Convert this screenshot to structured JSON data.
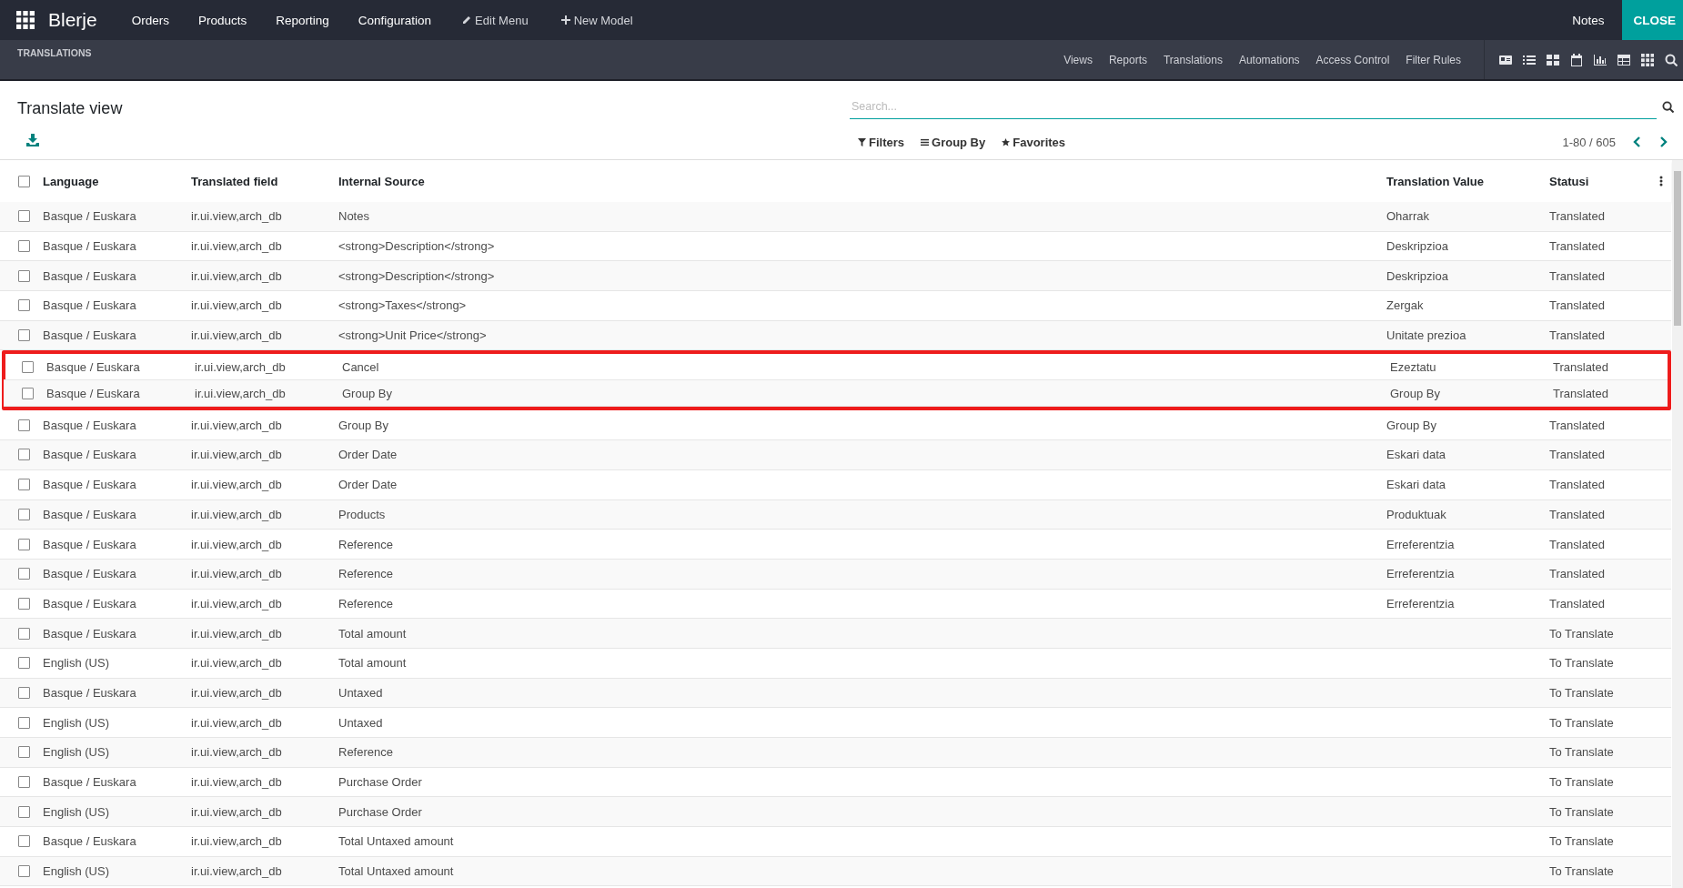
{
  "app": {
    "name": "Blerje",
    "menu": [
      "Orders",
      "Products",
      "Reporting",
      "Configuration"
    ],
    "actions": [
      {
        "kind": "edit",
        "label": "Edit Menu"
      },
      {
        "kind": "add",
        "label": "New Model"
      }
    ],
    "notes": "Notes",
    "close": "CLOSE"
  },
  "studio": {
    "title": "TRANSLATIONS",
    "tabs": [
      "Views",
      "Reports",
      "Translations",
      "Automations",
      "Access Control",
      "Filter Rules"
    ]
  },
  "control": {
    "title": "Translate view",
    "search": {
      "placeholder": "Search..."
    },
    "filters": [
      {
        "kind": "filter",
        "label": "Filters"
      },
      {
        "kind": "group",
        "label": "Group By"
      },
      {
        "kind": "favorite",
        "label": "Favorites"
      }
    ],
    "pager": "1-80 / 605"
  },
  "table": {
    "select_all": {
      "checked": false
    },
    "columns": [
      "Language",
      "Translated field",
      "Internal Source",
      "Translation Value",
      "Statusi"
    ],
    "rows": [
      {
        "cells": [
          "Basque / Euskara",
          "ir.ui.view,arch_db",
          "Notes",
          "Oharrak",
          "Translated"
        ],
        "selected": false,
        "outlined": false
      },
      {
        "cells": [
          "Basque / Euskara",
          "ir.ui.view,arch_db",
          "<strong>Description</strong>",
          "Deskripzioa",
          "Translated"
        ],
        "selected": false,
        "outlined": false
      },
      {
        "cells": [
          "Basque / Euskara",
          "ir.ui.view,arch_db",
          "<strong>Description</strong>",
          "Deskripzioa",
          "Translated"
        ],
        "selected": false,
        "outlined": false
      },
      {
        "cells": [
          "Basque / Euskara",
          "ir.ui.view,arch_db",
          "<strong>Taxes</strong>",
          "Zergak",
          "Translated"
        ],
        "selected": false,
        "outlined": false
      },
      {
        "cells": [
          "Basque / Euskara",
          "ir.ui.view,arch_db",
          "<strong>Unit Price</strong>",
          "Unitate prezioa",
          "Translated"
        ],
        "selected": false,
        "outlined": false
      },
      {
        "cells": [
          "Basque / Euskara",
          "ir.ui.view,arch_db",
          "Cancel",
          "Ezeztatu",
          "Translated"
        ],
        "selected": false,
        "outlined": true
      },
      {
        "cells": [
          "Basque / Euskara",
          "ir.ui.view,arch_db",
          "Group By",
          "Group By",
          "Translated"
        ],
        "selected": false,
        "outlined": true
      },
      {
        "cells": [
          "Basque / Euskara",
          "ir.ui.view,arch_db",
          "Group By",
          "Group By",
          "Translated"
        ],
        "selected": false,
        "outlined": false
      },
      {
        "cells": [
          "Basque / Euskara",
          "ir.ui.view,arch_db",
          "Order Date",
          "Eskari data",
          "Translated"
        ],
        "selected": false,
        "outlined": false
      },
      {
        "cells": [
          "Basque / Euskara",
          "ir.ui.view,arch_db",
          "Order Date",
          "Eskari data",
          "Translated"
        ],
        "selected": false,
        "outlined": false
      },
      {
        "cells": [
          "Basque / Euskara",
          "ir.ui.view,arch_db",
          "Products",
          "Produktuak",
          "Translated"
        ],
        "selected": false,
        "outlined": false
      },
      {
        "cells": [
          "Basque / Euskara",
          "ir.ui.view,arch_db",
          "Reference",
          "Erreferentzia",
          "Translated"
        ],
        "selected": false,
        "outlined": false
      },
      {
        "cells": [
          "Basque / Euskara",
          "ir.ui.view,arch_db",
          "Reference",
          "Erreferentzia",
          "Translated"
        ],
        "selected": false,
        "outlined": false
      },
      {
        "cells": [
          "Basque / Euskara",
          "ir.ui.view,arch_db",
          "Reference",
          "Erreferentzia",
          "Translated"
        ],
        "selected": false,
        "outlined": false
      },
      {
        "cells": [
          "Basque / Euskara",
          "ir.ui.view,arch_db",
          "Total amount",
          null,
          "To Translate"
        ],
        "selected": false,
        "outlined": false
      },
      {
        "cells": [
          "English (US)",
          "ir.ui.view,arch_db",
          "Total amount",
          null,
          "To Translate"
        ],
        "selected": false,
        "outlined": false
      },
      {
        "cells": [
          "Basque / Euskara",
          "ir.ui.view,arch_db",
          "Untaxed",
          null,
          "To Translate"
        ],
        "selected": false,
        "outlined": false
      },
      {
        "cells": [
          "English (US)",
          "ir.ui.view,arch_db",
          "Untaxed",
          null,
          "To Translate"
        ],
        "selected": false,
        "outlined": false
      },
      {
        "cells": [
          "English (US)",
          "ir.ui.view,arch_db",
          "Reference",
          null,
          "To Translate"
        ],
        "selected": false,
        "outlined": false
      },
      {
        "cells": [
          "Basque / Euskara",
          "ir.ui.view,arch_db",
          "Purchase Order",
          null,
          "To Translate"
        ],
        "selected": false,
        "outlined": false
      },
      {
        "cells": [
          "English (US)",
          "ir.ui.view,arch_db",
          "Purchase Order",
          null,
          "To Translate"
        ],
        "selected": false,
        "outlined": false
      },
      {
        "cells": [
          "Basque / Euskara",
          "ir.ui.view,arch_db",
          "Total Untaxed amount",
          null,
          "To Translate"
        ],
        "selected": false,
        "outlined": false
      },
      {
        "cells": [
          "English (US)",
          "ir.ui.view,arch_db",
          "Total Untaxed amount",
          null,
          "To Translate"
        ],
        "selected": false,
        "outlined": false
      }
    ]
  }
}
